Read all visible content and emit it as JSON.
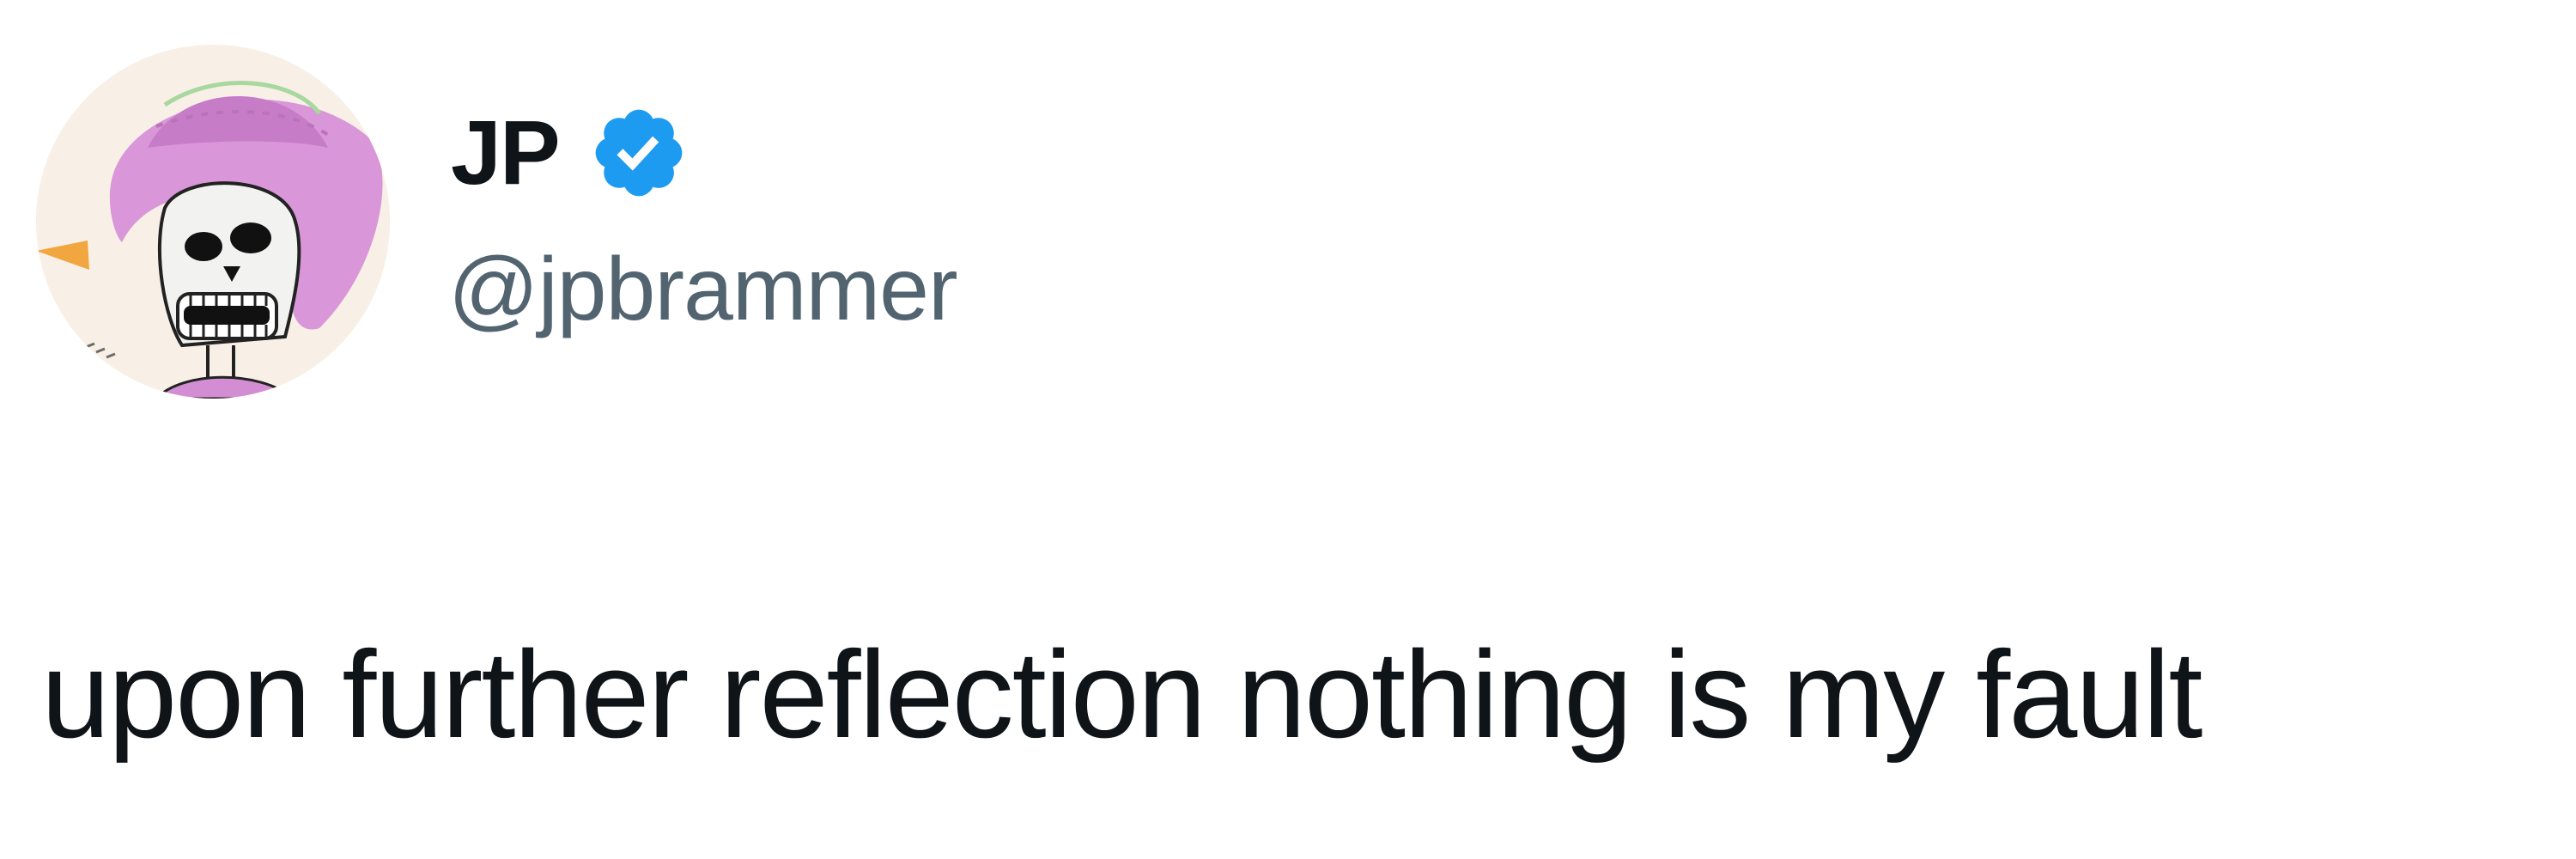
{
  "author": {
    "display_name": "JP",
    "handle": "@jpbrammer",
    "verified": true,
    "avatar_icon": "skeleton-sombrero-avatar"
  },
  "tweet": {
    "text": "upon further reflection nothing is my fault"
  },
  "colors": {
    "text_primary": "#0f1419",
    "text_secondary": "#536471",
    "verified_blue": "#1d9bf0",
    "background": "#ffffff"
  }
}
